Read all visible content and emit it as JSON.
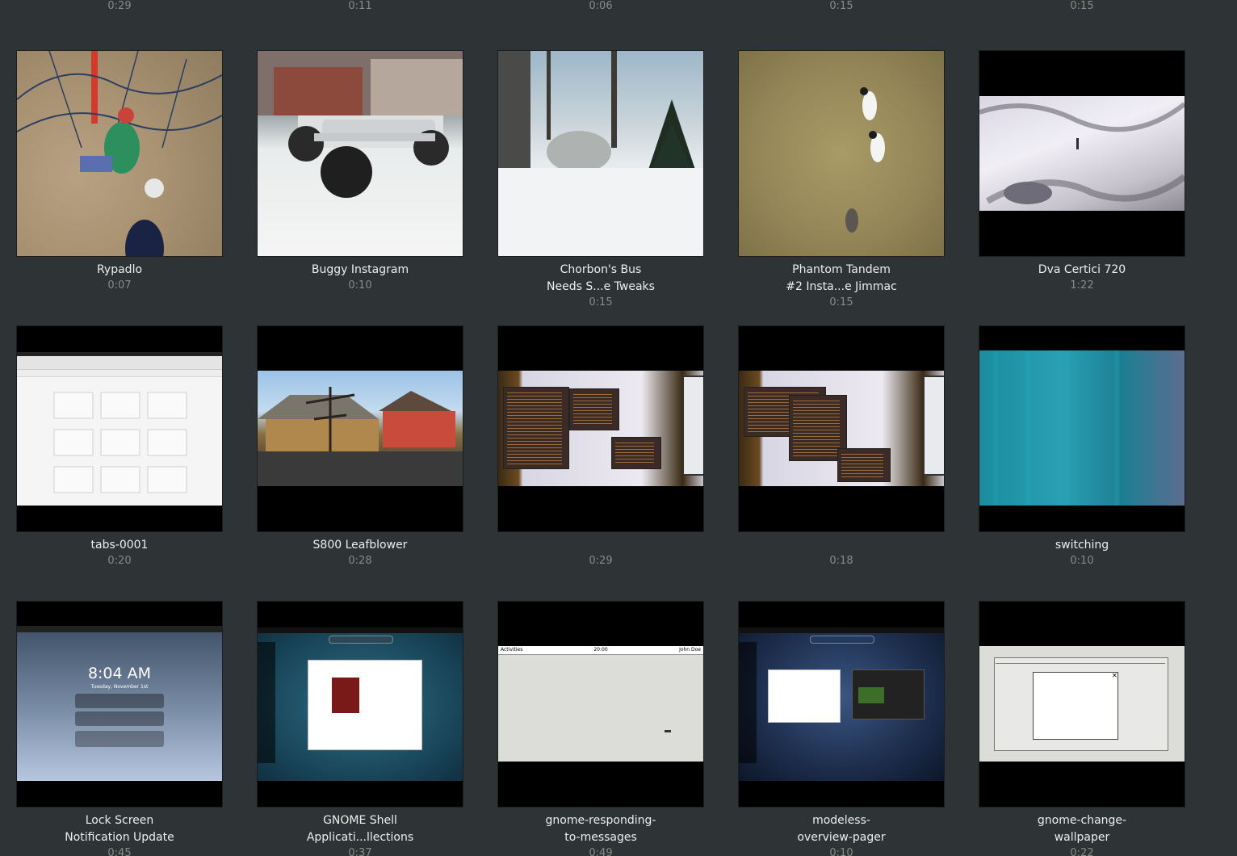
{
  "top_row_durations": [
    "0:29",
    "0:11",
    "0:06",
    "0:15",
    "0:15"
  ],
  "videos": [
    {
      "title_lines": [
        "Rypadlo"
      ],
      "duration": "0:07"
    },
    {
      "title_lines": [
        "Buggy Instagram"
      ],
      "duration": "0:10"
    },
    {
      "title_lines": [
        "Chorbon's Bus",
        "Needs S...e Tweaks"
      ],
      "duration": "0:15"
    },
    {
      "title_lines": [
        "Phantom Tandem",
        "#2 Insta...e Jimmac"
      ],
      "duration": "0:15"
    },
    {
      "title_lines": [
        "Dva Certici 720"
      ],
      "duration": "1:22"
    },
    {
      "title_lines": [
        "tabs-0001"
      ],
      "duration": "0:20"
    },
    {
      "title_lines": [
        "S800 Leafblower"
      ],
      "duration": "0:28"
    },
    {
      "title_lines": [
        ""
      ],
      "duration": "0:29"
    },
    {
      "title_lines": [
        ""
      ],
      "duration": "0:18"
    },
    {
      "title_lines": [
        "switching"
      ],
      "duration": "0:10"
    },
    {
      "title_lines": [
        "Lock Screen",
        "Notification Update"
      ],
      "duration": "0:45"
    },
    {
      "title_lines": [
        "GNOME Shell",
        "Applicati...llections"
      ],
      "duration": "0:37"
    },
    {
      "title_lines": [
        "gnome-responding-",
        "to-messages"
      ],
      "duration": "0:49"
    },
    {
      "title_lines": [
        "modeless-",
        "overview-pager"
      ],
      "duration": "0:10"
    },
    {
      "title_lines": [
        "gnome-change-",
        "wallpaper"
      ],
      "duration": "0:22"
    }
  ],
  "thumb_text": {
    "lock_time": "8:04 AM",
    "lock_date": "Tuesday, November 1st",
    "shell_time": "20:00",
    "activities": "Activities",
    "user_name": "John Doe"
  },
  "colors": {
    "background": "#2e3436",
    "title_text": "#eeeeec",
    "duration_text": "#888a85"
  }
}
